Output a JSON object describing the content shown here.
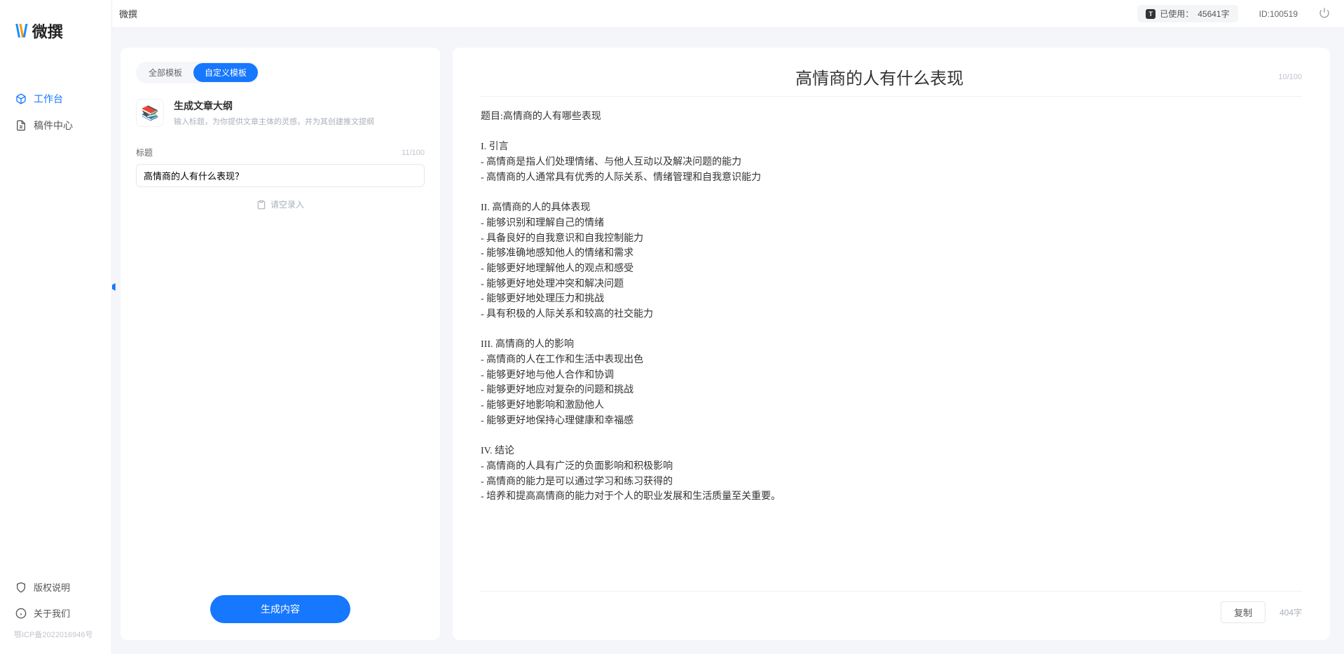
{
  "app": {
    "name": "微撰"
  },
  "sidebar": {
    "nav": [
      {
        "label": "工作台",
        "active": true
      },
      {
        "label": "稿件中心",
        "active": false
      }
    ],
    "footer": [
      {
        "label": "版权说明"
      },
      {
        "label": "关于我们"
      }
    ],
    "icp": "鄂ICP备2022016946号"
  },
  "topbar": {
    "title": "微撰",
    "usage_label": "已使用：",
    "usage_value": "45641字",
    "id_label": "ID:100519"
  },
  "left": {
    "tabs": [
      {
        "label": "全部模板",
        "active": false
      },
      {
        "label": "自定义模板",
        "active": true
      }
    ],
    "template": {
      "name": "生成文章大纲",
      "desc": "输入标题，为你提供文章主体的灵感，并为其创建推文提纲"
    },
    "field_label": "标题",
    "field_count": "11/100",
    "input_value": "高情商的人有什么表现？",
    "voice_label": "请空录入",
    "generate_label": "生成内容"
  },
  "right": {
    "title": "高情商的人有什么表现",
    "title_count": "10/100",
    "body": "题目:高情商的人有哪些表现\n\nI. 引言\n- 高情商是指人们处理情绪、与他人互动以及解决问题的能力\n- 高情商的人通常具有优秀的人际关系、情绪管理和自我意识能力\n\nII. 高情商的人的具体表现\n- 能够识别和理解自己的情绪\n- 具备良好的自我意识和自我控制能力\n- 能够准确地感知他人的情绪和需求\n- 能够更好地理解他人的观点和感受\n- 能够更好地处理冲突和解决问题\n- 能够更好地处理压力和挑战\n- 具有积极的人际关系和较高的社交能力\n\nIII. 高情商的人的影响\n- 高情商的人在工作和生活中表现出色\n- 能够更好地与他人合作和协调\n- 能够更好地应对复杂的问题和挑战\n- 能够更好地影响和激励他人\n- 能够更好地保持心理健康和幸福感\n\nIV. 结论\n- 高情商的人具有广泛的负面影响和积极影响\n- 高情商的能力是可以通过学习和练习获得的\n- 培养和提高高情商的能力对于个人的职业发展和生活质量至关重要。",
    "copy_label": "复制",
    "char_count": "404字"
  }
}
